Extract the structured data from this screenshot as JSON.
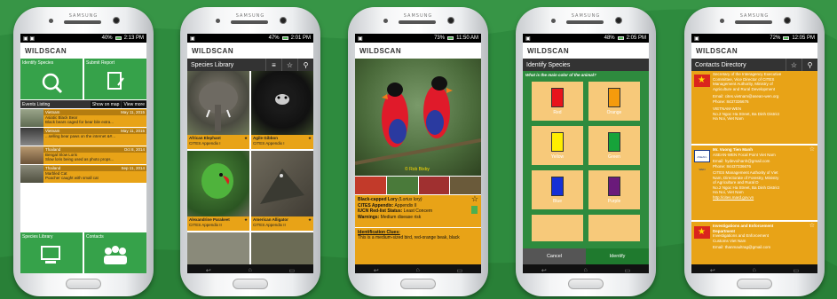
{
  "brand": "SAMSUNG",
  "app": {
    "logo_text": "WILDSCAN"
  },
  "phones": [
    {
      "status": {
        "left": "▣ ▣",
        "right": "40%",
        "time": "2:13 PM"
      },
      "home": {
        "tile_identify": "Identify Species",
        "tile_report": "Submit Report",
        "events_label": "Events Listing",
        "show_on_map": "Show on map",
        "view_more": "View more",
        "events": [
          {
            "place": "Vietnam",
            "date": "May 11, 2015",
            "title": "Asiatic Black Bear",
            "desc": "Black bears caged for bear bile extra..."
          },
          {
            "place": "Vietnam",
            "date": "May 11, 2015",
            "title": "",
            "desc": "...selling bear paws on the internet &#..."
          },
          {
            "place": "Thailand",
            "date": "Oct 8, 2014",
            "title": "Bengal Slow Loris",
            "desc": "Slow loris being used as photo props..."
          },
          {
            "place": "Thailand",
            "date": "Sep 11, 2014",
            "title": "Marbled Cat",
            "desc": "Poacher caught with small cat"
          }
        ],
        "tile_library": "Species Library",
        "tile_contacts": "Contacts"
      }
    },
    {
      "status": {
        "right": "47%",
        "time": "2:01 PM"
      },
      "library": {
        "title": "Species Library",
        "items": [
          {
            "name": "African Elephant",
            "cites": "CITES Appendix I"
          },
          {
            "name": "Agile Gibbon",
            "cites": "CITES Appendix I"
          },
          {
            "name": "Alexandrine Parakeet",
            "cites": "CITES Appendix II"
          },
          {
            "name": "American Alligator",
            "cites": "CITES Appendix II"
          }
        ]
      }
    },
    {
      "status": {
        "right": "73%",
        "time": "11:50 AM"
      },
      "detail": {
        "credit": "© Rob Bixby",
        "name": "Black-capped Lory",
        "latin": "(Lorius lory)",
        "cites_label": "CITES Appendix:",
        "cites_value": "Appendix II",
        "iucn_label": "IUCN Red-list Status:",
        "iucn_value": "Least Concern",
        "warn_label": "Warnings:",
        "warn_value": "Medium disease risk",
        "clues_label": "Identification Clues:",
        "clues_text": "This is a medium-sized bird, red-orange beak, black"
      }
    },
    {
      "status": {
        "right": "48%",
        "time": "2:05 PM"
      },
      "identify": {
        "title": "Identify Species",
        "question": "What is the main color of the animal?",
        "colors": [
          {
            "label": "Red",
            "hex": "#e8141b"
          },
          {
            "label": "Orange",
            "hex": "#f59b0c"
          },
          {
            "label": "Yellow",
            "hex": "#ffee00"
          },
          {
            "label": "Green",
            "hex": "#16a33a"
          },
          {
            "label": "Blue",
            "hex": "#1530d6"
          },
          {
            "label": "Purple",
            "hex": "#6a1a7a"
          }
        ],
        "cancel": "Cancel",
        "identify": "Identify"
      }
    },
    {
      "status": {
        "right": "72%",
        "time": "12:05 PM"
      },
      "contacts": {
        "title": "Contacts Directory",
        "c1": {
          "lines": [
            "Secretary of the Interagency Executive",
            "Committee, Vice Director of CITES",
            "Management Authority, Ministry of",
            "Agriculture and Rural Development"
          ],
          "email": "Email: cites.vietnam@asean-wen.org",
          "phone": "Phone: 8437336676",
          "org": "VIETNAM-WEN",
          "addr": "No.2 Ngoc Ha Street, Ba Dinh District",
          "city": "Ha Noi, Viet Nam"
        },
        "c2": {
          "name": "Mr. Vuong Tien Manh",
          "role": "ASEAN-WEN Focal Point Viet Nam",
          "email": "Email: hydevoihanh@gmail.com",
          "phone": "Phone: 84437336676",
          "lines": [
            "CITES Management Authority of Viet",
            "Nam, Directorate of Forestry, Ministry",
            "of Agriculture and Rural D",
            "No.2 Ngoc Ha Street, Ba Dinh District",
            "Ha Noi, Viet Nam"
          ],
          "link": "http://cites.mard.gov.vn",
          "logo": "ASEAN-WEN"
        },
        "c3": {
          "name": "Investigations and Enforcement",
          "role": "Department",
          "lines": [
            "Investigations and Enforcement",
            "Customs Viet Nam"
          ],
          "email": "Email: thanmaultrag@gmail.com"
        }
      }
    }
  ],
  "colors": {
    "bg": "#2e8b3e",
    "accent": "#e8a317",
    "tile": "#36a24a"
  }
}
